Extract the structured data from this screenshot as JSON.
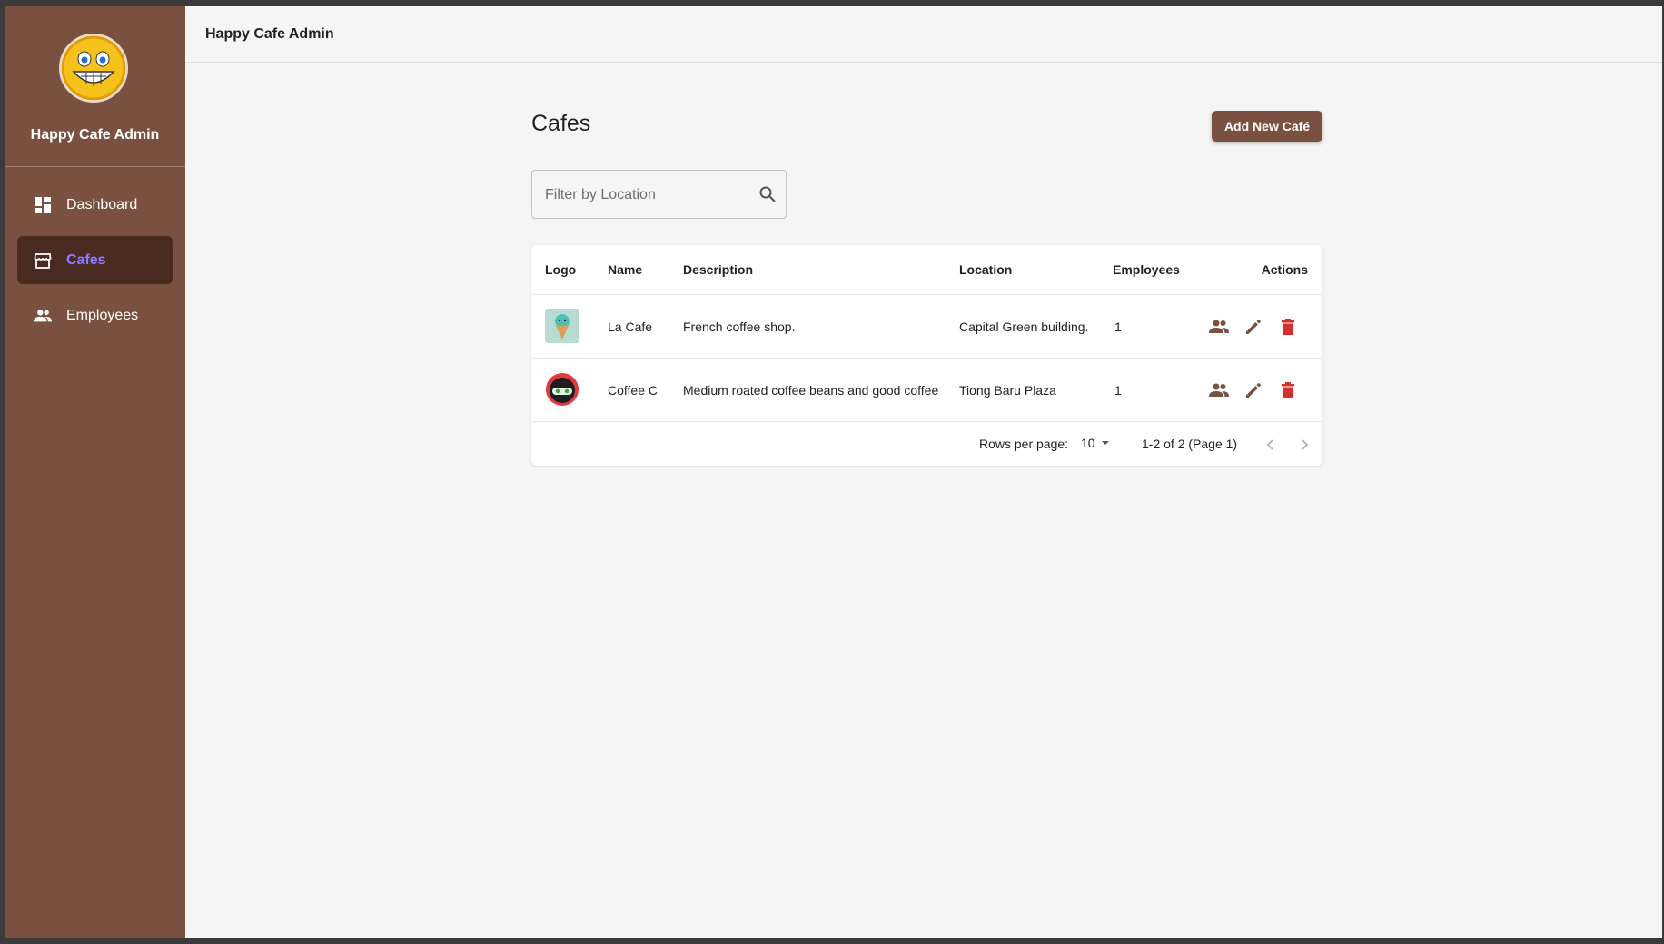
{
  "app": {
    "title": "Happy Cafe Admin"
  },
  "sidebar": {
    "brand_name": "Happy Cafe Admin",
    "items": [
      {
        "label": "Dashboard",
        "icon": "dashboard-icon"
      },
      {
        "label": "Cafes",
        "icon": "store-icon",
        "active": true
      },
      {
        "label": "Employees",
        "icon": "people-icon"
      }
    ]
  },
  "topbar": {
    "title": "Happy Cafe Admin"
  },
  "main": {
    "page_title": "Cafes",
    "add_button_label": "Add New Café",
    "filter": {
      "placeholder": "Filter by Location",
      "value": ""
    }
  },
  "table": {
    "headers": {
      "logo": "Logo",
      "name": "Name",
      "description": "Description",
      "location": "Location",
      "employees": "Employees",
      "actions": "Actions"
    },
    "rows": [
      {
        "logo": "ice-cream-logo",
        "name": "La Cafe",
        "description": "French coffee shop.",
        "location": "Capital Green building.",
        "employees": "1"
      },
      {
        "logo": "ninja-logo",
        "name": "Coffee C",
        "description": "Medium roated coffee beans and good coffee",
        "location": "Tiong Baru Plaza",
        "employees": "1"
      }
    ],
    "pagination": {
      "rows_per_page_label": "Rows per page:",
      "rows_per_page": "10",
      "page_info": "1-2 of 2 (Page 1)"
    }
  },
  "colors": {
    "sidebar": "#7a5140",
    "active_item": "#4a2b22",
    "active_text": "#8b7dff",
    "delete": "#d32f2f",
    "action_icon": "#7a5140"
  }
}
